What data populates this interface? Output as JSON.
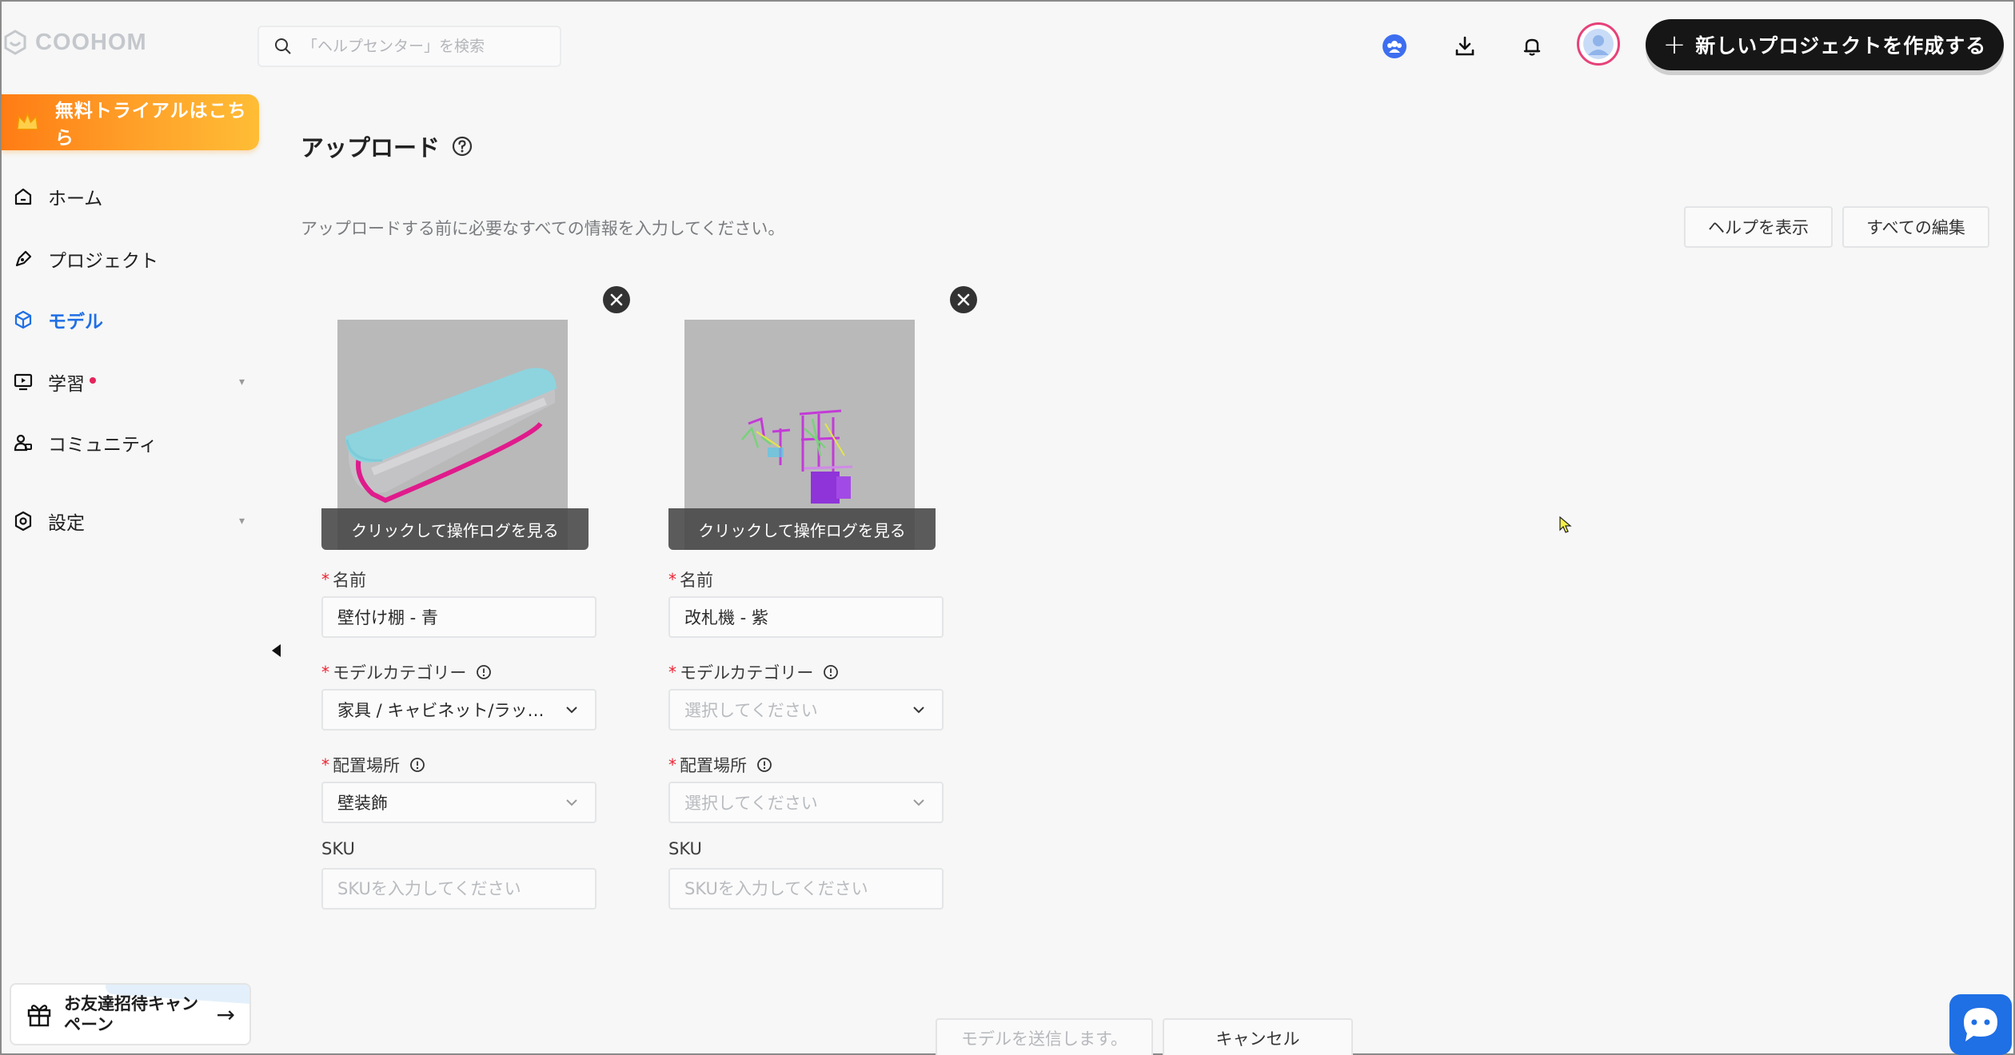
{
  "app": {
    "logo_text": "COOHOM"
  },
  "search": {
    "placeholder": "「ヘルプセンター」を検索"
  },
  "header": {
    "icons": [
      "team-icon",
      "download-icon",
      "bell-icon",
      "avatar"
    ],
    "new_project_label": "新しいプロジェクトを作成する"
  },
  "sidebar": {
    "trial_label": "無料トライアルはこちら",
    "items": [
      {
        "label": "ホーム",
        "icon": "home-icon",
        "active": false
      },
      {
        "label": "プロジェクト",
        "icon": "project-icon",
        "active": false
      },
      {
        "label": "モデル",
        "icon": "cube-icon",
        "active": true
      },
      {
        "label": "学習",
        "icon": "learning-icon",
        "active": false,
        "has_dot": true,
        "expandable": true
      },
      {
        "label": "コミュニティ",
        "icon": "community-icon",
        "active": false
      },
      {
        "label": "設定",
        "icon": "settings-icon",
        "active": false,
        "expandable": true
      }
    ],
    "invite_label": "お友達招待キャンペーン"
  },
  "main": {
    "title": "アップロード",
    "subtitle": "アップロードする前に必要なすべての情報を入力してください。",
    "help_button": "ヘルプを表示",
    "edit_all_button": "すべての編集",
    "cards": [
      {
        "log_label": "クリックして操作ログを見る",
        "name_label": "名前",
        "name_value": "壁付け棚 - 青",
        "category_label": "モデルカテゴリー",
        "category_value": "家具 / キャビネット/ラッ…",
        "location_label": "配置場所",
        "location_value": "壁装飾",
        "sku_label": "SKU",
        "sku_placeholder": "SKUを入力してください"
      },
      {
        "log_label": "クリックして操作ログを見る",
        "name_label": "名前",
        "name_value": "改札機 - 紫",
        "category_label": "モデルカテゴリー",
        "category_placeholder": "選択してください",
        "location_label": "配置場所",
        "location_placeholder": "選択してください",
        "sku_label": "SKU",
        "sku_placeholder": "SKUを入力してください"
      }
    ],
    "submit_button": "モデルを送信します。",
    "cancel_button": "キャンセル"
  },
  "colors": {
    "accent_blue": "#1f6fe5",
    "trial_orange": "#ff8c1a",
    "required_red": "#ee2233",
    "primary_black": "#161616"
  }
}
